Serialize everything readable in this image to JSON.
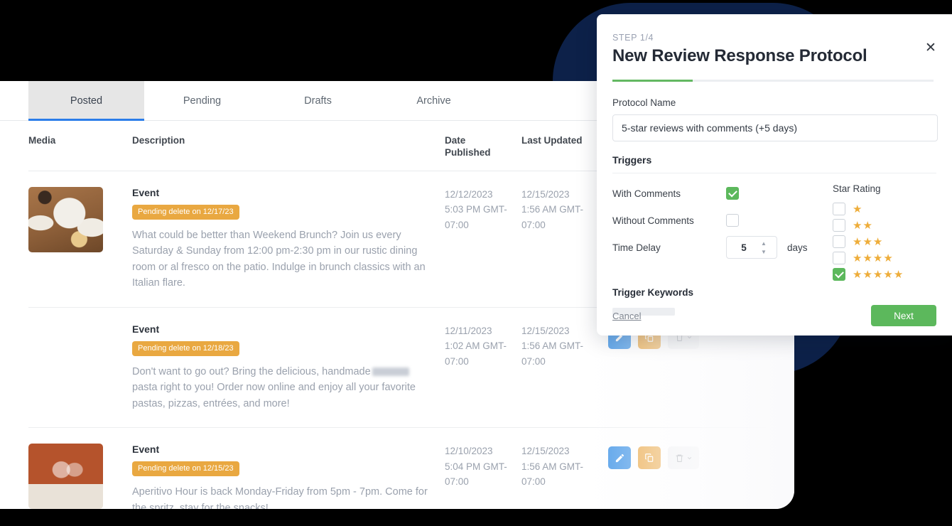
{
  "tabs": [
    {
      "label": "Posted",
      "active": true
    },
    {
      "label": "Pending",
      "active": false
    },
    {
      "label": "Drafts",
      "active": false
    },
    {
      "label": "Archive",
      "active": false
    }
  ],
  "table": {
    "headers": {
      "media": "Media",
      "description": "Description",
      "date_published": "Date\nPublished",
      "date_published_l1": "Date",
      "date_published_l2": "Published",
      "last_updated_l1": "Last Updated",
      "actions": ""
    },
    "rows": [
      {
        "kind": "Event",
        "badge": "Pending delete on 12/17/23",
        "description": "What could be better than Weekend Brunch? Join us every Saturday & Sunday from 12:00 pm-2:30 pm in our rustic dining room or al fresco on the patio. Indulge in brunch classics with an Italian flare.",
        "redacted": false,
        "date_published": "12/12/2023 5:03 PM GMT-07:00",
        "date_published_l1": "12/12/2023",
        "date_published_l2": "5:03 PM GMT-",
        "date_published_l3": "07:00",
        "last_updated_l1": "12/15/2023",
        "last_updated_l2": "1:56 AM GMT-",
        "last_updated_l3": "07:00",
        "thumb_alt": "brunch-table-photo",
        "actions_visible": false
      },
      {
        "kind": "Event",
        "badge": "Pending delete on 12/18/23",
        "desc_before": "Don't want to go out? Bring the delicious, handmade",
        "desc_after": "pasta right to you! Order now online and enjoy all your favorite pastas, pizzas, entrées, and more!",
        "redacted": true,
        "date_published_l1": "12/11/2023",
        "date_published_l2": "1:02 AM GMT-",
        "date_published_l3": "07:00",
        "last_updated_l1": "12/15/2023",
        "last_updated_l2": "1:56 AM GMT-",
        "last_updated_l3": "07:00",
        "thumb_alt": "takeout-container-photo",
        "actions_visible": true
      },
      {
        "kind": "Event",
        "badge": "Pending delete on 12/15/23",
        "description": "Aperitivo Hour is back Monday-Friday from 5pm - 7pm. Come for the spritz, stay for the snacks!",
        "redacted": false,
        "date_published_l1": "12/10/2023",
        "date_published_l2": "5:04 PM GMT-",
        "date_published_l3": "07:00",
        "last_updated_l1": "12/15/2023",
        "last_updated_l2": "1:56 AM GMT-",
        "last_updated_l3": "07:00",
        "thumb_alt": "wine-toast-photo",
        "actions_visible": true
      }
    ],
    "action_buttons": {
      "edit": "pencil-icon",
      "copy": "copy-icon",
      "delete": "trash-icon"
    }
  },
  "modal": {
    "step": "STEP 1/4",
    "title": "New Review Response Protocol",
    "close_icon": "close-icon",
    "progress_percent": 25,
    "protocol_name_label": "Protocol Name",
    "protocol_name_value": "5-star reviews with comments (+5 days)",
    "triggers_title": "Triggers",
    "with_comments_label": "With Comments",
    "with_comments_checked": true,
    "without_comments_label": "Without Comments",
    "without_comments_checked": false,
    "time_delay_label": "Time Delay",
    "time_delay_value": "5",
    "time_delay_unit": "days",
    "star_rating_label": "Star Rating",
    "star_rows": [
      {
        "stars": 1,
        "checked": false
      },
      {
        "stars": 2,
        "checked": false
      },
      {
        "stars": 3,
        "checked": false
      },
      {
        "stars": 4,
        "checked": false
      },
      {
        "stars": 5,
        "checked": true
      }
    ],
    "trigger_keywords_label": "Trigger Keywords",
    "cancel_label": "Cancel",
    "next_label": "Next"
  },
  "colors": {
    "accent_green": "#5cb85c",
    "star_amber": "#eead3a",
    "badge_amber": "#e9a841",
    "tab_underline_blue": "#2b7de9",
    "edit_blue": "#4a9ae8",
    "copy_orange": "#eba845",
    "navy_blob": "#0d2149"
  }
}
